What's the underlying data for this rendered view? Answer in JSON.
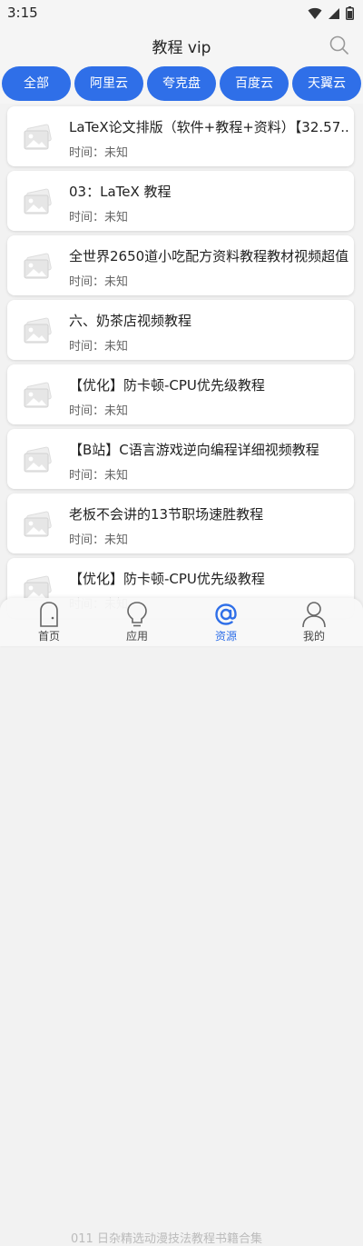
{
  "status": {
    "time": "3:15"
  },
  "header": {
    "title": "教程 vip"
  },
  "tabs": [
    "全部",
    "阿里云",
    "夸克盘",
    "百度云",
    "天翼云"
  ],
  "items": [
    {
      "title": "LaTeX论文排版（软件+教程+资料）【32.57...",
      "time": "时间：未知"
    },
    {
      "title": "03：LaTeX 教程",
      "time": "时间：未知"
    },
    {
      "title": "全世界2650道小吃配方资料教程教材视频超值",
      "time": "时间：未知"
    },
    {
      "title": "六、奶茶店视频教程",
      "time": "时间：未知"
    },
    {
      "title": "【优化】防卡顿-CPU优先级教程",
      "time": "时间：未知"
    },
    {
      "title": "【B站】C语言游戏逆向编程详细视频教程",
      "time": "时间：未知"
    },
    {
      "title": "老板不会讲的13节职场速胜教程",
      "time": "时间：未知"
    },
    {
      "title": "【优化】防卡顿-CPU优先级教程",
      "time": "时间：未知"
    }
  ],
  "peek_text": "011 日杂精选动漫技法教程书籍合集",
  "nav": [
    {
      "label": "首页",
      "icon": "home-icon"
    },
    {
      "label": "应用",
      "icon": "lightbulb-icon"
    },
    {
      "label": "资源",
      "icon": "at-icon",
      "active": true
    },
    {
      "label": "我的",
      "icon": "user-icon"
    }
  ],
  "colors": {
    "accent": "#2f6fe8",
    "background": "#f2f2f2"
  }
}
